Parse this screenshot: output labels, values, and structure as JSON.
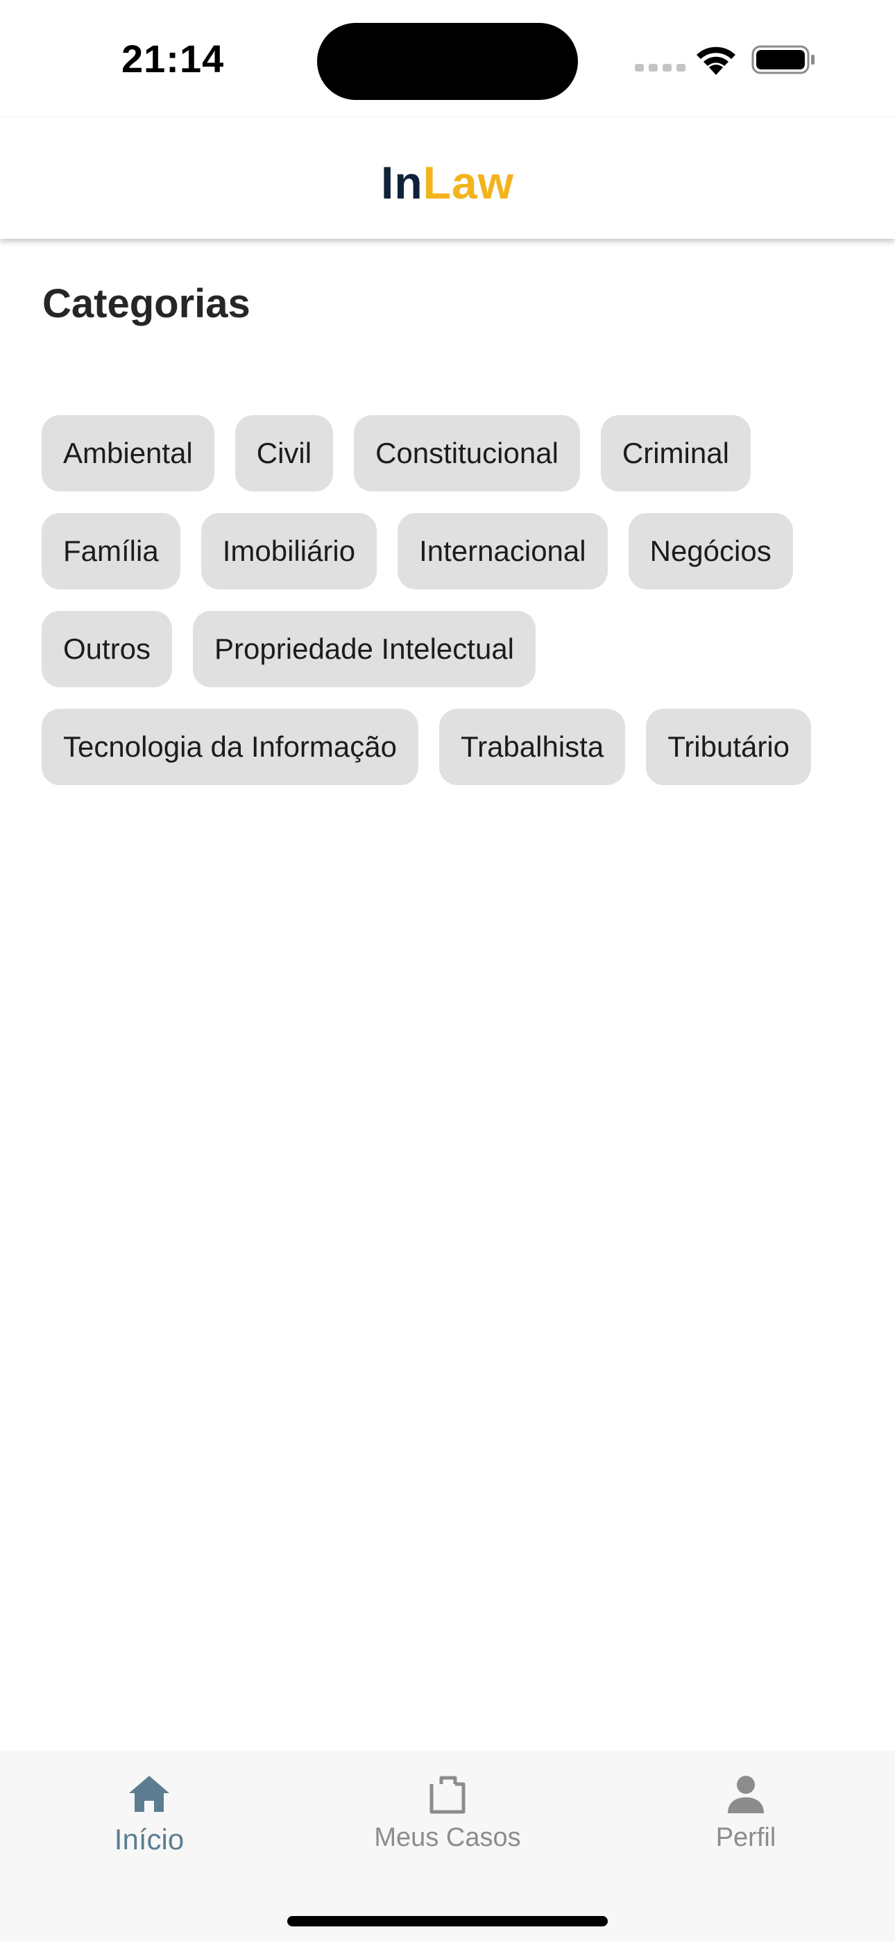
{
  "status_bar": {
    "time": "21:14"
  },
  "header": {
    "brand_part1": "In",
    "brand_part2": "Law",
    "brand_color_dark": "#0f2238",
    "brand_color_accent": "#f2b31c"
  },
  "main": {
    "section_title": "Categorias",
    "categories": [
      "Ambiental",
      "Civil",
      "Constitucional",
      "Criminal",
      "Família",
      "Imobiliário",
      "Internacional",
      "Negócios",
      "Outros",
      "Propriedade Intelectual",
      "Tecnologia da Informação",
      "Trabalhista",
      "Tributário"
    ]
  },
  "tab_bar": {
    "active_color": "#5c7d91",
    "inactive_color": "#8c8c8c",
    "tabs": [
      {
        "label": "Início",
        "icon": "home-icon",
        "active": true
      },
      {
        "label": "Meus Casos",
        "icon": "briefcase-icon",
        "active": false
      },
      {
        "label": "Perfil",
        "icon": "person-icon",
        "active": false
      }
    ]
  }
}
